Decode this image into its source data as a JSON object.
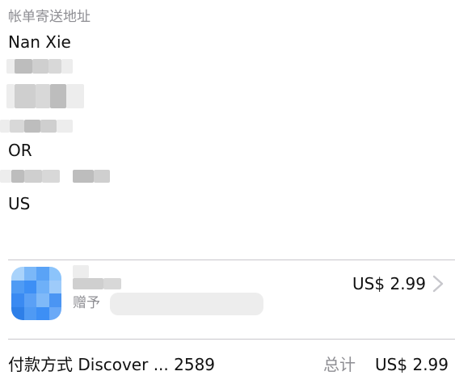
{
  "billing": {
    "title": "帐单寄送地址",
    "name": "Nan Xie",
    "state": "OR",
    "country": "US"
  },
  "item": {
    "price": "US$ 2.99",
    "gift_label": "赠予",
    "icon": "app-icon",
    "accent": "#3d8ff5"
  },
  "footer": {
    "payment_label": "付款方式",
    "payment_method": "Discover ... 2589",
    "total_label": "总计",
    "total_value": "US$ 2.99"
  }
}
